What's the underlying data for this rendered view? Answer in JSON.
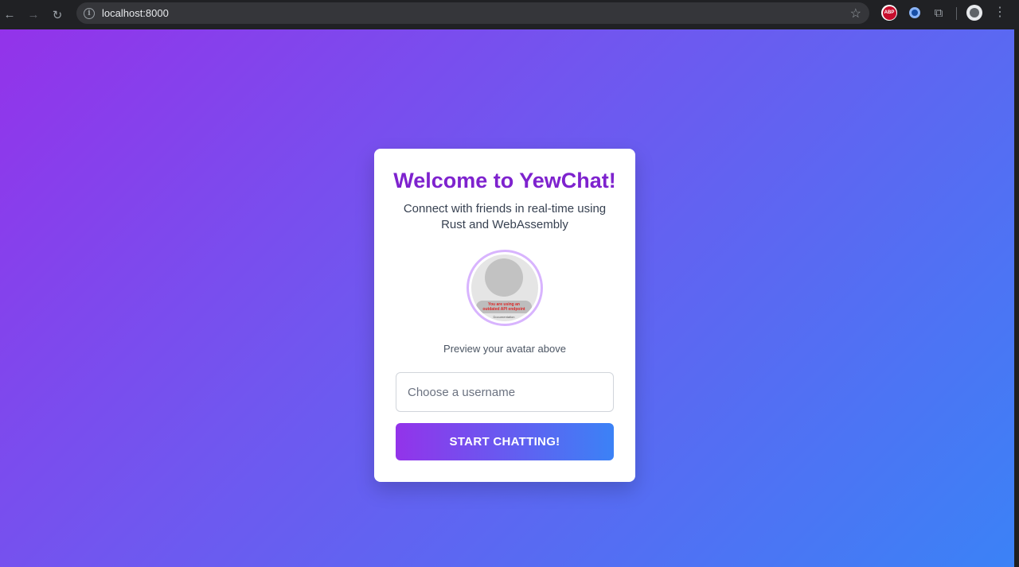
{
  "browser": {
    "url": "localhost:8000",
    "back_glyph": "←",
    "forward_glyph": "→",
    "reload_glyph": "↻",
    "site_info_glyph": "i",
    "star_glyph": "☆",
    "puzzle_glyph": "⧉",
    "menu_glyph": "⋮",
    "extension_abp_label": "ABP"
  },
  "card": {
    "title": "Welcome to YewChat!",
    "subtitle": "Connect with friends in real-time using Rust and WebAssembly",
    "avatar": {
      "warning_line1": "You are using an",
      "warning_line2": "outdated API endpoint",
      "doc_label": "Documentation"
    },
    "avatar_caption": "Preview your avatar above",
    "username_placeholder": "Choose a username",
    "username_value": "",
    "start_label": "START CHATTING!"
  },
  "colors": {
    "title": "#7e22ce",
    "gradient_start": "#9333ea",
    "gradient_end": "#3b82f6",
    "avatar_ring": "#d8b4fe"
  }
}
